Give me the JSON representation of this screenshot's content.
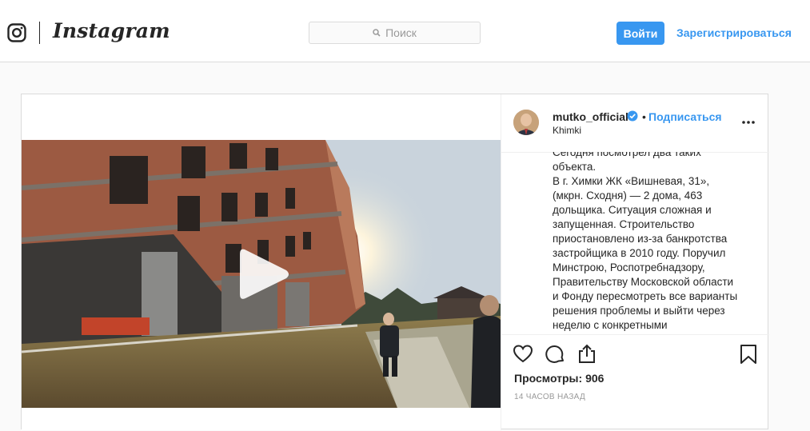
{
  "nav": {
    "logo_icon": "instagram-camera-icon",
    "wordmark": "Instagram",
    "search_placeholder": "Поиск",
    "search_icon": "search-icon",
    "login_label": "Войти",
    "signup_label": "Зарегистрироваться",
    "accent_color": "#3897f0"
  },
  "post": {
    "media": {
      "type": "video",
      "play_icon": "play-icon"
    },
    "author": {
      "username": "mutko_official",
      "verified": true,
      "verified_icon": "verified-badge-icon",
      "separator": "•",
      "follow_label": "Подписаться",
      "location": "Khimki"
    },
    "more_icon": "more-options-icon",
    "caption": "Сегодня посмотрел два таких\nобъекта.\nВ г. Химки ЖК «Вишневая, 31»,\n(мкрн. Сходня) — 2 дома, 463\nдольщика. Ситуация сложная и\nзапущенная. Строительство\nприостановлено из-за банкротства\nзастройщика в 2010 году. Поручил\nМинстрою, Роспотребнадзору,\nПравительству Московской области\nи Фонду пересмотреть все варианты\nрешения проблемы и выйти через\nнеделю с конкретными\nпредложениями.",
    "actions": {
      "like_icon": "heart-icon",
      "comment_icon": "comment-icon",
      "share_icon": "share-icon",
      "save_icon": "bookmark-icon"
    },
    "views_label": "Просмотры:",
    "views_count": "906",
    "timestamp": "14 часов назад"
  }
}
